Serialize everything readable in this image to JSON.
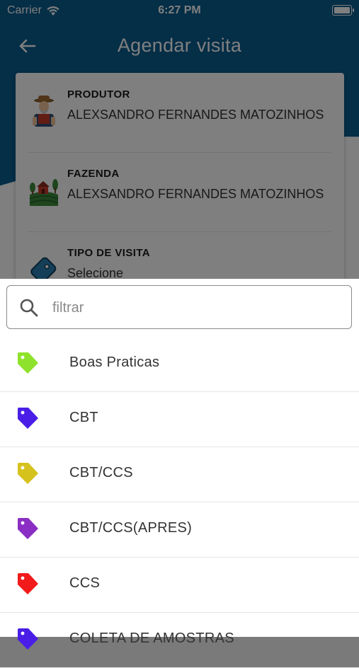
{
  "status_bar": {
    "carrier": "Carrier",
    "time": "6:27 PM"
  },
  "header": {
    "title": "Agendar visita"
  },
  "card": {
    "rows": [
      {
        "label": "PRODUTOR",
        "value": "ALEXSANDRO FERNANDES MATOZINHOS",
        "icon": "farmer-icon"
      },
      {
        "label": "FAZENDA",
        "value": "ALEXSANDRO FERNANDES MATOZINHOS",
        "icon": "farm-icon"
      },
      {
        "label": "TIPO DE VISITA",
        "value": "Selecione",
        "icon": "tag-icon"
      }
    ]
  },
  "sheet": {
    "search_placeholder": "filtrar",
    "items": [
      {
        "label": "Boas Praticas",
        "color": "#8fe22b"
      },
      {
        "label": "CBT",
        "color": "#4a1ee6"
      },
      {
        "label": "CBT/CCS",
        "color": "#d6c21c"
      },
      {
        "label": "CBT/CCS(APRES)",
        "color": "#8b2fc4"
      },
      {
        "label": "CCS",
        "color": "#f21a1a"
      },
      {
        "label": "COLETA DE AMOSTRAS",
        "color": "#4a1ee6"
      }
    ]
  }
}
